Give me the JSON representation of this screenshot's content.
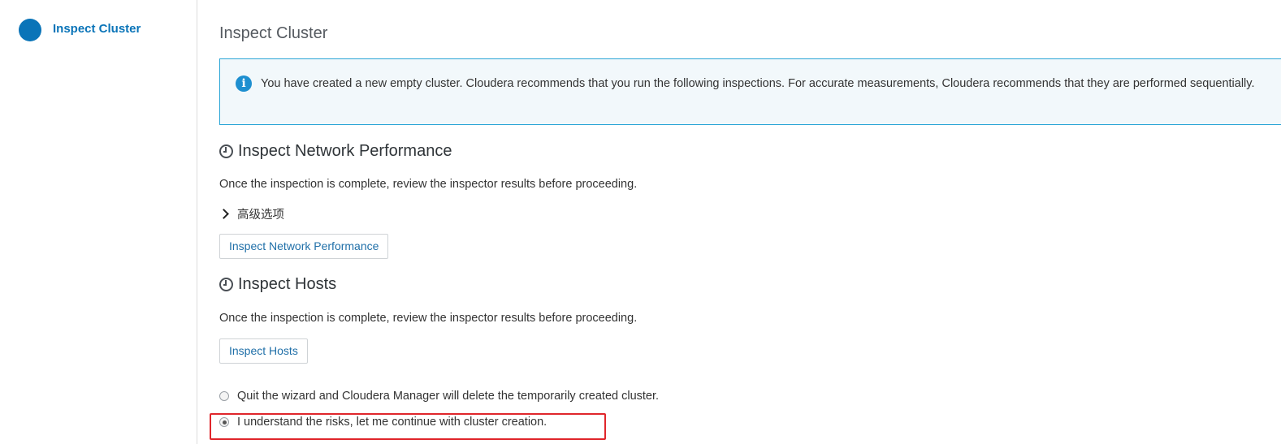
{
  "sidebar": {
    "steps": [
      {
        "label": "Inspect Cluster",
        "active": true
      }
    ]
  },
  "main": {
    "title": "Inspect Cluster",
    "info": {
      "icon": "info-icon",
      "text": "You have created a new empty cluster. Cloudera recommends that you run the following inspections. For accurate measurements, Cloudera recommends that they are performed sequentially."
    },
    "network": {
      "icon": "clock-icon",
      "heading": "Inspect Network Performance",
      "description": "Once the inspection is complete, review the inspector results before proceeding.",
      "advanced_label": "高级选项",
      "button_label": "Inspect Network Performance"
    },
    "hosts": {
      "icon": "clock-icon",
      "heading": "Inspect Hosts",
      "description": "Once the inspection is complete, review the inspector results before proceeding.",
      "button_label": "Inspect Hosts"
    },
    "options": [
      {
        "label": "Quit the wizard and Cloudera Manager will delete the temporarily created cluster.",
        "checked": false
      },
      {
        "label": "I understand the risks, let me continue with cluster creation.",
        "checked": true
      }
    ]
  },
  "colors": {
    "accent": "#0a74b8",
    "info_border": "#29a5d6",
    "info_background": "#f2f8fb",
    "link": "#1f6fa8",
    "highlight": "#e0262b"
  }
}
